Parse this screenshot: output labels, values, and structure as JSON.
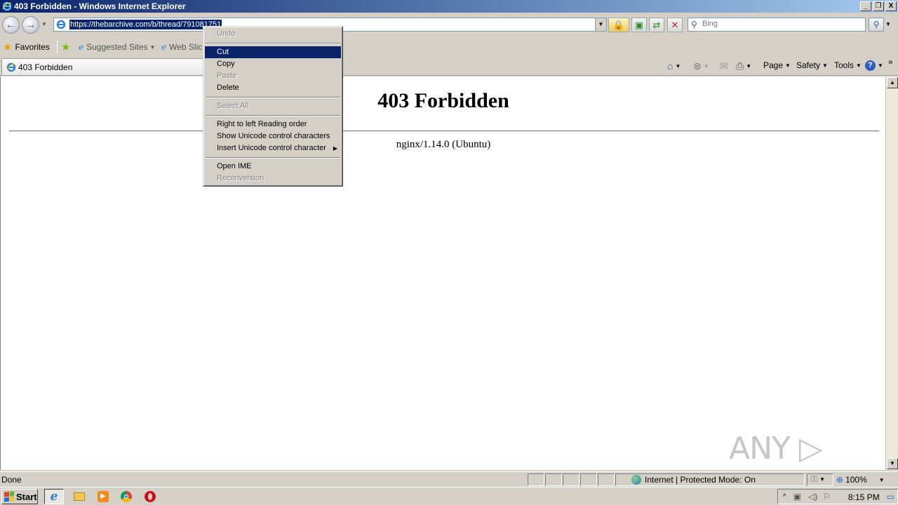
{
  "window": {
    "title": "403 Forbidden - Windows Internet Explorer",
    "minimize": "_",
    "restore": "❐",
    "close": "X"
  },
  "nav": {
    "url": "https://thebarchive.com/b/thread/791081751",
    "search_placeholder": "Bing"
  },
  "favorites": {
    "favorites_label": "Favorites",
    "suggested_sites_label": "Suggested Sites",
    "web_slice_label": "Web Slic"
  },
  "tab": {
    "title": "403 Forbidden"
  },
  "command_bar": {
    "page_label": "Page",
    "safety_label": "Safety",
    "tools_label": "Tools",
    "more": "»"
  },
  "page": {
    "heading": "403 Forbidden",
    "server": "nginx/1.14.0 (Ubuntu)",
    "watermark": "ANY ▷ RUN"
  },
  "context_menu": {
    "items": [
      {
        "label": "Undo",
        "disabled": true
      },
      {
        "separator": true
      },
      {
        "label": "Cut",
        "highlighted": true
      },
      {
        "label": "Copy"
      },
      {
        "label": "Paste",
        "disabled": true
      },
      {
        "label": "Delete"
      },
      {
        "separator": true
      },
      {
        "label": "Select All",
        "disabled": true
      },
      {
        "separator": true
      },
      {
        "label": "Right to left Reading order"
      },
      {
        "label": "Show Unicode control characters"
      },
      {
        "label": "Insert Unicode control character",
        "submenu": true
      },
      {
        "separator": true
      },
      {
        "label": "Open IME"
      },
      {
        "label": "Reconversion",
        "disabled": true
      }
    ]
  },
  "status": {
    "text": "Done",
    "zone": "Internet | Protected Mode: On",
    "zoom": "100%"
  },
  "taskbar": {
    "start_label": "Start",
    "clock": "8:15 PM"
  },
  "colors": {
    "selection": "#0a246a",
    "chrome": "#d4d0c8"
  },
  "icons": [
    "ie-icon",
    "back-icon",
    "forward-icon",
    "lock-icon",
    "compat-icon",
    "refresh-icon",
    "stop-icon",
    "search-icon",
    "home-icon",
    "rss-icon",
    "mail-icon",
    "print-icon",
    "help-icon",
    "globe-icon",
    "windows-flag-icon",
    "explorer-folder-icon",
    "media-player-icon",
    "chrome-icon",
    "opera-icon"
  ]
}
